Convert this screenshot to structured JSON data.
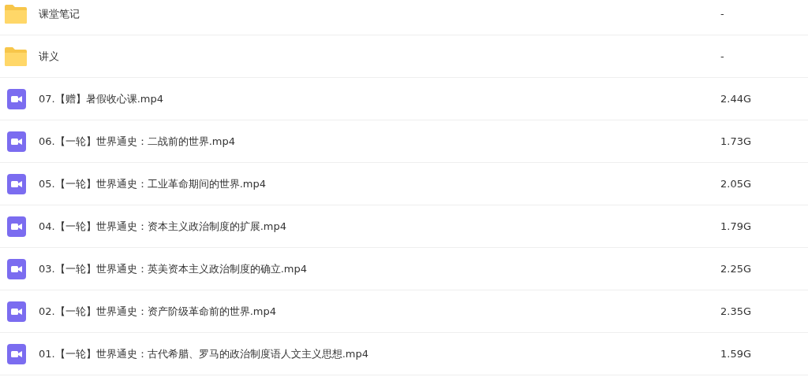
{
  "files": [
    {
      "kind": "folder",
      "name": "课堂笔记",
      "size": "-"
    },
    {
      "kind": "folder",
      "name": "讲义",
      "size": "-"
    },
    {
      "kind": "video",
      "name": "07.【赠】暑假收心课.mp4",
      "size": "2.44G"
    },
    {
      "kind": "video",
      "name": "06.【一轮】世界通史：二战前的世界.mp4",
      "size": "1.73G"
    },
    {
      "kind": "video",
      "name": "05.【一轮】世界通史：工业革命期间的世界.mp4",
      "size": "2.05G"
    },
    {
      "kind": "video",
      "name": "04.【一轮】世界通史：资本主义政治制度的扩展.mp4",
      "size": "1.79G"
    },
    {
      "kind": "video",
      "name": "03.【一轮】世界通史：英美资本主义政治制度的确立.mp4",
      "size": "2.25G"
    },
    {
      "kind": "video",
      "name": "02.【一轮】世界通史：资产阶级革命前的世界.mp4",
      "size": "2.35G"
    },
    {
      "kind": "video",
      "name": "01.【一轮】世界通史：古代希腊、罗马的政治制度语人文主义思想.mp4",
      "size": "1.59G"
    }
  ]
}
